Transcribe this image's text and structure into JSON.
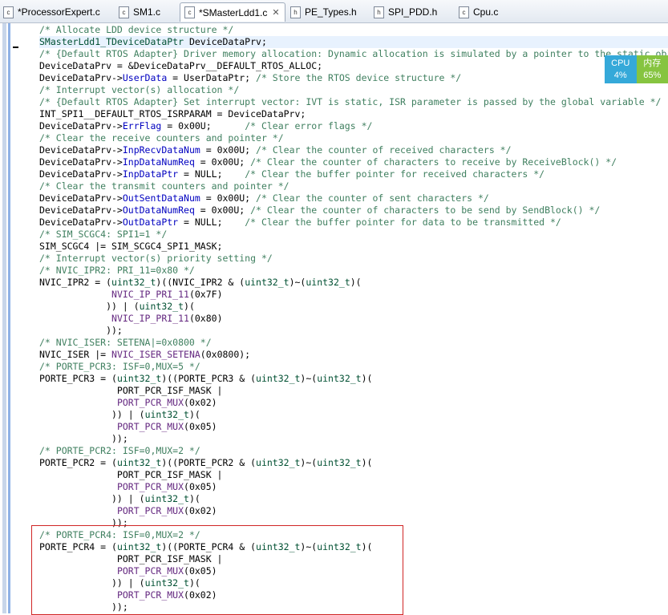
{
  "tabs": [
    {
      "label": "*ProcessorExpert.c",
      "icon": "c-file-icon",
      "active": false
    },
    {
      "label": "SM1.c",
      "icon": "c-file-icon",
      "active": false
    },
    {
      "label": "*SMasterLdd1.c",
      "icon": "c-file-icon",
      "active": true,
      "close": "✕"
    },
    {
      "label": "PE_Types.h",
      "icon": "h-file-icon",
      "active": false
    },
    {
      "label": "SPI_PDD.h",
      "icon": "h-file-icon",
      "active": false
    },
    {
      "label": "Cpu.c",
      "icon": "c-file-icon",
      "active": false
    }
  ],
  "monitor": {
    "cpu_label": "CPU",
    "cpu_value": "4%",
    "mem_label": "内存",
    "mem_value": "65%"
  },
  "code_lines": [
    "/* Allocate LDD device structure */",
    "SMasterLdd1_TDeviceDataPtr DeviceDataPrv;",
    "/* {Default RTOS Adapter} Driver memory allocation: Dynamic allocation is simulated by a pointer to the static object */",
    "DeviceDataPrv = &DeviceDataPrv__DEFAULT_RTOS_ALLOC;",
    "DeviceDataPrv->UserData = UserDataPtr; /* Store the RTOS device structure */",
    "/* Interrupt vector(s) allocation */",
    "/* {Default RTOS Adapter} Set interrupt vector: IVT is static, ISR parameter is passed by the global variable */",
    "INT_SPI1__DEFAULT_RTOS_ISRPARAM = DeviceDataPrv;",
    "DeviceDataPrv->ErrFlag = 0x00U;      /* Clear error flags */",
    "/* Clear the receive counters and pointer */",
    "DeviceDataPrv->InpRecvDataNum = 0x00U; /* Clear the counter of received characters */",
    "DeviceDataPrv->InpDataNumReq = 0x00U; /* Clear the counter of characters to receive by ReceiveBlock() */",
    "DeviceDataPrv->InpDataPtr = NULL;    /* Clear the buffer pointer for received characters */",
    "/* Clear the transmit counters and pointer */",
    "DeviceDataPrv->OutSentDataNum = 0x00U; /* Clear the counter of sent characters */",
    "DeviceDataPrv->OutDataNumReq = 0x00U; /* Clear the counter of characters to be send by SendBlock() */",
    "DeviceDataPrv->OutDataPtr = NULL;    /* Clear the buffer pointer for data to be transmitted */",
    "/* SIM_SCGC4: SPI1=1 */",
    "SIM_SCGC4 |= SIM_SCGC4_SPI1_MASK;",
    "/* Interrupt vector(s) priority setting */",
    "/* NVIC_IPR2: PRI_11=0x80 */",
    "NVIC_IPR2 = (uint32_t)((NVIC_IPR2 & (uint32_t)~(uint32_t)(",
    "             NVIC_IP_PRI_11(0x7F)",
    "            )) | (uint32_t)(",
    "             NVIC_IP_PRI_11(0x80)",
    "            ));",
    "/* NVIC_ISER: SETENA|=0x0800 */",
    "NVIC_ISER |= NVIC_ISER_SETENA(0x0800);",
    "/* PORTE_PCR3: ISF=0,MUX=5 */",
    "PORTE_PCR3 = (uint32_t)((PORTE_PCR3 & (uint32_t)~(uint32_t)(",
    "              PORT_PCR_ISF_MASK |",
    "              PORT_PCR_MUX(0x02)",
    "             )) | (uint32_t)(",
    "              PORT_PCR_MUX(0x05)",
    "             ));",
    "/* PORTE_PCR2: ISF=0,MUX=2 */",
    "PORTE_PCR2 = (uint32_t)((PORTE_PCR2 & (uint32_t)~(uint32_t)(",
    "              PORT_PCR_ISF_MASK |",
    "              PORT_PCR_MUX(0x05)",
    "             )) | (uint32_t)(",
    "              PORT_PCR_MUX(0x02)",
    "             ));",
    "/* PORTE_PCR4: ISF=0,MUX=2 */",
    "PORTE_PCR4 = (uint32_t)((PORTE_PCR4 & (uint32_t)~(uint32_t)(",
    "              PORT_PCR_ISF_MASK |",
    "              PORT_PCR_MUX(0x05)",
    "             )) | (uint32_t)(",
    "              PORT_PCR_MUX(0x02)",
    "             ));"
  ],
  "highlighted_line": 1,
  "colors": {
    "comment": "#3f7f5f",
    "field": "#0000c0",
    "type": "#005032",
    "macro": "#642880",
    "current_line": "#e8f2fe",
    "annotation_box": "#d02525",
    "cpu_badge": "#35a9d9",
    "mem_badge": "#86c440"
  }
}
